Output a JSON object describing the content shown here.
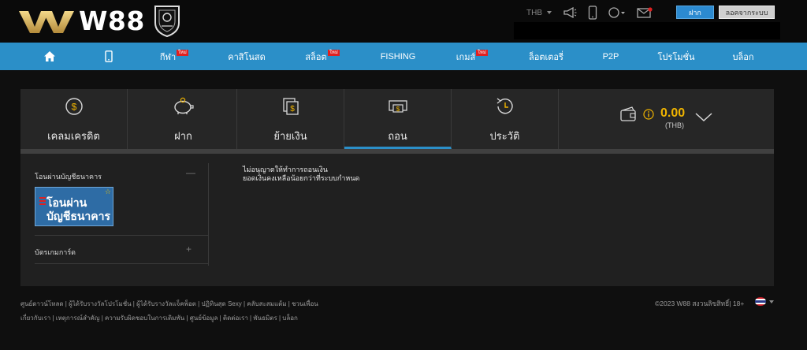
{
  "header": {
    "logo_text": "W88",
    "currency": "THB",
    "deposit_label": "ฝาก",
    "logout_label": "ลอคจากระบบ"
  },
  "nav": {
    "items": [
      {
        "label": ""
      },
      {
        "label": ""
      },
      {
        "label": "กีฬา",
        "badge": "ใหม่"
      },
      {
        "label": "คาสิโนสด"
      },
      {
        "label": "สล็อต",
        "badge": "ใหม่"
      },
      {
        "label": "FISHING"
      },
      {
        "label": "เกมส์",
        "badge": "ใหม่"
      },
      {
        "label": "ล็อตเตอรี่"
      },
      {
        "label": "P2P"
      },
      {
        "label": "โปรโมชั่น"
      },
      {
        "label": "บล็อก"
      }
    ]
  },
  "tabs": [
    {
      "label": "เคลมเครดิต",
      "icon": "coin-icon"
    },
    {
      "label": "ฝาก",
      "icon": "piggy-bank-icon"
    },
    {
      "label": "ย้ายเงิน",
      "icon": "transfer-icon"
    },
    {
      "label": "ถอน",
      "icon": "withdraw-icon"
    },
    {
      "label": "ประวัติ",
      "icon": "history-icon"
    }
  ],
  "wallet": {
    "amount": "0.00",
    "currency": "(THB)"
  },
  "withdraw": {
    "bank_section_title": "โอนผ่านบัญชีธนาคาร",
    "bank_section_toggle": "—",
    "bank_card_line1": "โอนผ่าน",
    "bank_card_line2": "บัญชีธนาคาร",
    "game_card_title": "บัตรเกมการ์ด",
    "game_card_toggle": "+",
    "message_line1": "ไม่อนุญาตให้ทำการถอนเงิน",
    "message_line2": "ยอดเงินคงเหลือน้อยกว่าที่ระบบกำหนด"
  },
  "footer": {
    "links_row1": "ศูนย์ดาวน์โหลด | ผู้ได้รับรางวัลโปรโมชั่น | ผู้ได้รับรางวัลแจ็คพ็อต | ปฏิทินสุด Sexy | คลับสะสมแต้ม | ชวนเพื่อน",
    "links_row2": "เกี่ยวกับเรา | เหตุการณ์สำคัญ | ความรับผิดชอบในการเดิมพัน | ศูนย์ข้อมูล | ติดต่อเรา | พันธมิตร | บล็อก",
    "copyright": "©2023 W88 สงวนลิขสิทธิ์| 18+"
  },
  "colors": {
    "accent": "#2b8fc8",
    "gold": "#f0b400",
    "badge": "#e02020"
  }
}
